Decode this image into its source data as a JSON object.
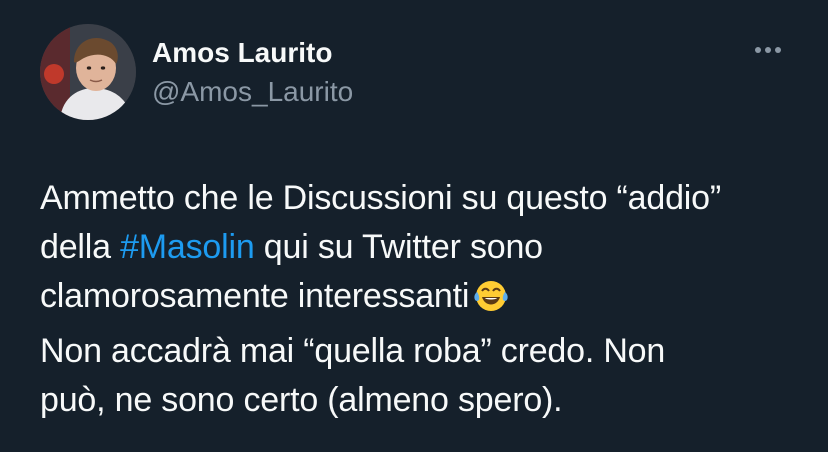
{
  "author": {
    "display_name": "Amos Laurito",
    "handle": "@Amos_Laurito"
  },
  "more_icon": "more-horizontal-icon",
  "tweet": {
    "line1": "Ammetto che le Discussioni su questo “addio”",
    "line2_before": "della ",
    "line2_hashtag": "#Masolin",
    "line2_after": " qui su Twitter sono",
    "line3": "clamorosamente interessanti",
    "line3_emoji": "face-with-tears-of-joy-emoji",
    "line4": "Non accadrà mai “quella roba” credo. Non",
    "line5": "può, ne sono certo (almeno spero)."
  },
  "colors": {
    "background": "#15202b",
    "text": "#f7f9f9",
    "secondary": "#8b98a5",
    "link": "#1d9bf0"
  }
}
